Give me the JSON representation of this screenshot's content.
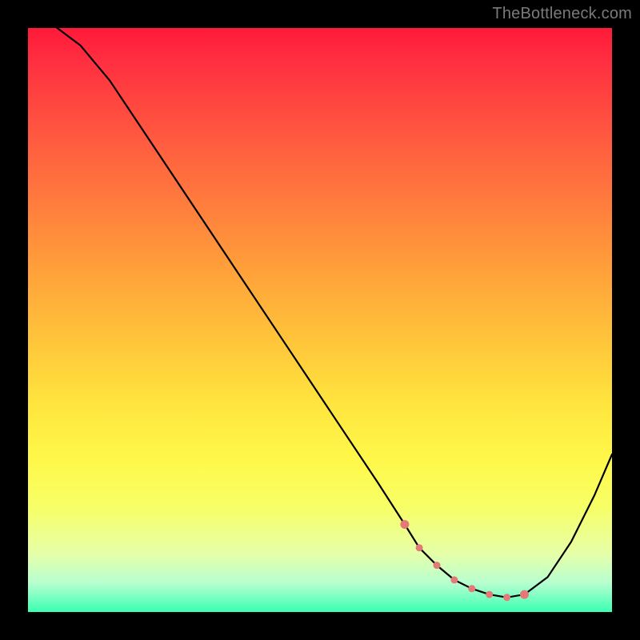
{
  "watermark": "TheBottleneck.com",
  "chart_data": {
    "type": "line",
    "title": "",
    "xlabel": "",
    "ylabel": "",
    "xlim": [
      0,
      100
    ],
    "ylim": [
      0,
      100
    ],
    "grid": false,
    "series": [
      {
        "name": "curve",
        "x": [
          5,
          9,
          14,
          20,
          28,
          36,
          44,
          52,
          60,
          64.5,
          67,
          70,
          73,
          76,
          79,
          82,
          85,
          89,
          93,
          97,
          100
        ],
        "values": [
          100,
          97,
          91,
          82,
          70,
          58,
          46,
          34,
          22,
          15,
          11,
          8,
          5.5,
          4,
          3,
          2.5,
          3,
          6,
          12,
          20,
          27
        ]
      }
    ],
    "markers": {
      "name": "highlight-dots",
      "color": "#e37a78",
      "x": [
        64.5,
        67,
        70,
        73,
        76,
        79,
        82,
        85
      ],
      "values": [
        15,
        11,
        8,
        5.5,
        4,
        3,
        2.5,
        3
      ]
    },
    "background_gradient": {
      "top": "#ff1a3a",
      "mid": "#ffe43e",
      "bottom": "#3affb3"
    }
  }
}
